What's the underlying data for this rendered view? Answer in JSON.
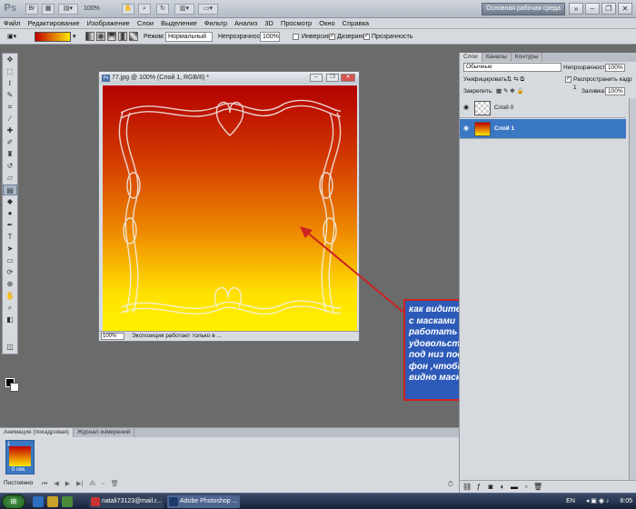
{
  "app": {
    "logo": "Ps",
    "zoom": "100%",
    "workspace": "Основная рабочая среда"
  },
  "menu": [
    "Файл",
    "Редактирование",
    "Изображение",
    "Слои",
    "Выделение",
    "Фильтр",
    "Анализ",
    "3D",
    "Просмотр",
    "Окно",
    "Справка"
  ],
  "options": {
    "mode_label": "Режим:",
    "mode_value": "Нормальный",
    "opacity_label": "Непрозрачность:",
    "opacity_value": "100%",
    "invert_label": "Инверсия",
    "dither_label": "Дизеринг",
    "transparency_label": "Прозрачность"
  },
  "document": {
    "title": "77.jpg @ 100% (Слой 1, RGB/8) *",
    "zoom": "100%",
    "status": "Экспозиция работает только в ..."
  },
  "callout": {
    "text": "как видите теперь с масками работать одно удовольствие, я под низ поставила фон ,чтобы было видно маску...."
  },
  "layers_panel": {
    "tabs": [
      "Слои",
      "Каналы",
      "Контуры"
    ],
    "blend_mode": "Обычные",
    "opacity_label": "Непрозрачность:",
    "opacity_value": "100%",
    "unify_label": "Унифицировать:",
    "propagate_label": "Распространить кадр 1",
    "lock_label": "Закрепить:",
    "fill_label": "Заливка:",
    "fill_value": "100%",
    "layers": [
      {
        "name": "Слой 0",
        "selected": false
      },
      {
        "name": "Слой 1",
        "selected": true
      }
    ]
  },
  "animation_panel": {
    "tabs": [
      "Анимация (покадровая)",
      "Журнал измерений"
    ],
    "frame_number": "1",
    "frame_duration": "0 сек.",
    "loop": "Постоянно"
  },
  "taskbar": {
    "language": "EN",
    "time": "8:05",
    "tasks": [
      "natali73123@mail.r...",
      "Adobe Photoshop ..."
    ]
  },
  "colors": {
    "accent": "#3a78c3",
    "callout_bg": "#2d5ab8",
    "callout_border": "#cc2222",
    "gradient_top": "#b30000",
    "gradient_bottom": "#fff200"
  }
}
